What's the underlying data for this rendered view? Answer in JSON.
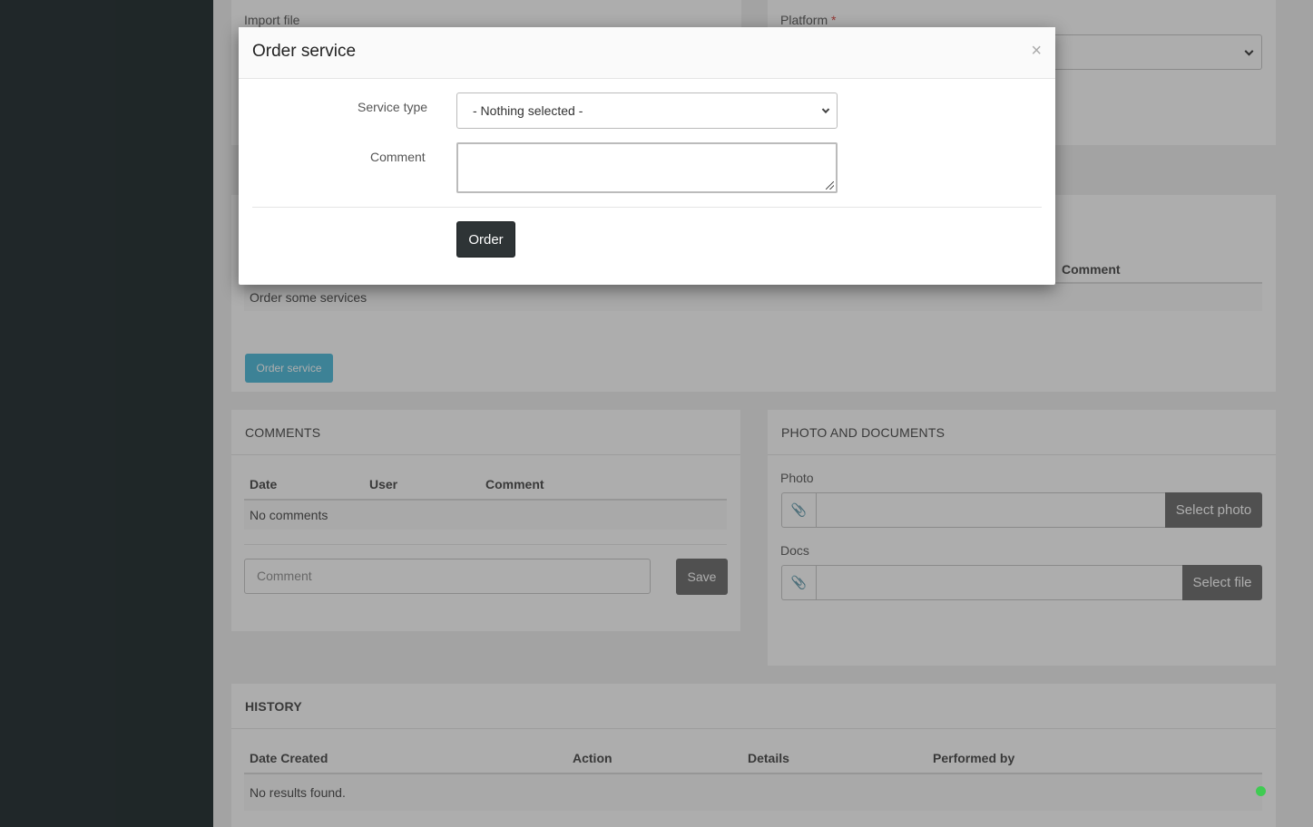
{
  "top_form": {
    "import_file_label": "Import file",
    "platform_label": "Platform",
    "platform_required": "*"
  },
  "services": {
    "comment_header": "Comment",
    "empty_text": "Order some services",
    "order_button": "Order service"
  },
  "comments": {
    "title": "COMMENTS",
    "columns": [
      "Date",
      "User",
      "Comment"
    ],
    "empty_text": "No comments",
    "input_placeholder": "Comment",
    "save_button": "Save"
  },
  "photos": {
    "title": "PHOTO AND DOCUMENTS",
    "photo_label": "Photo",
    "photo_button": "Select photo",
    "docs_label": "Docs",
    "docs_button": "Select file"
  },
  "history": {
    "title": "HISTORY",
    "columns": [
      "Date Created",
      "Action",
      "Details",
      "Performed by"
    ],
    "empty_text": "No results found."
  },
  "modal": {
    "title": "Order service",
    "close": "×",
    "service_type_label": "Service type",
    "service_type_value": "- Nothing selected -",
    "comment_label": "Comment",
    "order_button": "Order"
  },
  "colors": {
    "sidebar": "#2f3a3c",
    "order_service_button": "#5bc0de",
    "save_button": "#777777",
    "modal_order_button": "#2e3436",
    "status_dot": "#3fcb52"
  }
}
